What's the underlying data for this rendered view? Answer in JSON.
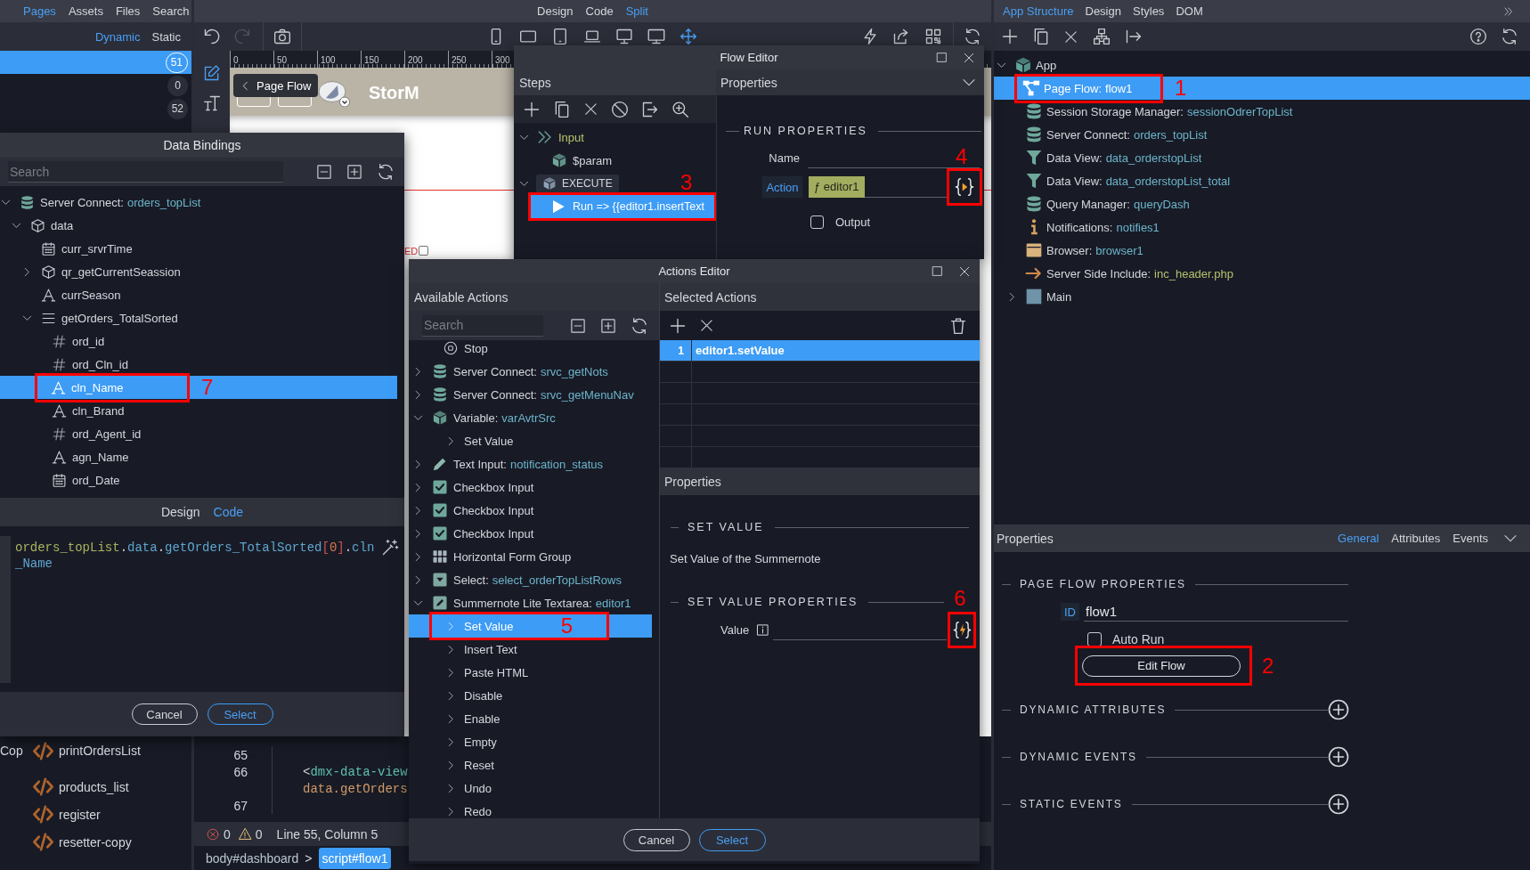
{
  "left_panel": {
    "tabs": [
      {
        "label": "Pages",
        "selected": true
      },
      {
        "label": "Assets",
        "selected": false
      },
      {
        "label": "Files",
        "selected": false
      },
      {
        "label": "Search",
        "selected": false
      }
    ],
    "filter_tabs": [
      {
        "label": "Dynamic",
        "selected": true
      },
      {
        "label": "Static",
        "selected": false
      }
    ],
    "page_rows": [
      {
        "count": "51",
        "selected": true
      },
      {
        "count": "0",
        "selected": false
      },
      {
        "count": "52",
        "selected": false
      }
    ],
    "file_rows": [
      {
        "prefix": "Cop",
        "name": "printOrdersList"
      },
      {
        "name": "products_list"
      },
      {
        "name": "register"
      },
      {
        "name": "resetter-copy"
      }
    ]
  },
  "center": {
    "view_tabs": [
      {
        "label": "Design",
        "selected": false
      },
      {
        "label": "Code",
        "selected": false
      },
      {
        "label": "Split",
        "selected": true
      }
    ],
    "history_buttons": [
      {
        "disabled": false
      },
      {
        "disabled": true
      }
    ],
    "device_buttons": [
      {
        "selected": false
      },
      {
        "selected": false
      },
      {
        "selected": false
      },
      {
        "selected": false
      },
      {
        "selected": false
      },
      {
        "selected": false
      },
      {
        "selected": true
      }
    ],
    "ruler_labels": [
      "0",
      "50",
      "100",
      "150",
      "200",
      "250",
      "300"
    ],
    "canvas": {
      "tooltip": "Page Flow",
      "brand": "StorM",
      "cut_label": "ED",
      "checkbox": {
        "checked": false
      }
    },
    "code_lines": [
      {
        "number": "65"
      },
      {
        "number": "66",
        "kind": "tag",
        "bracket": "<",
        "text": "dmx-data-view"
      },
      {
        "kind": "value",
        "text": "data.getOrders"
      },
      {
        "number": "67"
      }
    ],
    "status_bar": {
      "errors": "0",
      "warnings": "0",
      "position": "Line 55, Column 5"
    },
    "breadcrumb": [
      {
        "label": "body#dashboard",
        "selected": false
      },
      {
        "label": "script#flow1",
        "selected": true
      }
    ],
    "breadcrumb_separator": ">"
  },
  "data_bindings": {
    "title": "Data Bindings",
    "search": {
      "placeholder": "Search"
    },
    "tree": [
      {
        "kind": "server",
        "label": "Server Connect:",
        "value": "orders_topList",
        "expanded": true,
        "selected": false,
        "children": [
          {
            "kind": "object",
            "label": "data",
            "expanded": true,
            "selected": false,
            "children": [
              {
                "kind": "date",
                "label": "curr_srvrTime",
                "selected": false
              },
              {
                "kind": "object",
                "label": "qr_getCurrentSeassion",
                "expanded": false,
                "selected": false
              },
              {
                "kind": "text",
                "label": "currSeason",
                "selected": false
              },
              {
                "kind": "array",
                "label": "getOrders_TotalSorted",
                "expanded": true,
                "selected": false,
                "children": [
                  {
                    "kind": "number",
                    "label": "ord_id",
                    "selected": false
                  },
                  {
                    "kind": "number",
                    "label": "ord_Cln_id",
                    "selected": false
                  },
                  {
                    "kind": "text",
                    "label": "cln_Name",
                    "selected": true,
                    "callout": "7"
                  },
                  {
                    "kind": "text",
                    "label": "cln_Brand",
                    "selected": false
                  },
                  {
                    "kind": "number",
                    "label": "ord_Agent_id",
                    "selected": false
                  },
                  {
                    "kind": "text",
                    "label": "agn_Name",
                    "selected": false
                  },
                  {
                    "kind": "date",
                    "label": "ord_Date",
                    "selected": false
                  }
                ]
              }
            ]
          }
        ]
      }
    ],
    "tabs": [
      {
        "label": "Design",
        "selected": false
      },
      {
        "label": "Code",
        "selected": true
      }
    ],
    "expression": [
      {
        "kind": "root",
        "text": "orders_topList"
      },
      {
        "kind": "punct",
        "text": "."
      },
      {
        "kind": "prop",
        "text": "data"
      },
      {
        "kind": "punct",
        "text": "."
      },
      {
        "kind": "prop",
        "text": "getOrders_TotalSorted"
      },
      {
        "kind": "bracket",
        "text": "["
      },
      {
        "kind": "index",
        "text": "0"
      },
      {
        "kind": "bracket",
        "text": "]"
      },
      {
        "kind": "punct",
        "text": "."
      },
      {
        "kind": "prop",
        "text": "cln_Name"
      }
    ],
    "buttons": [
      {
        "label": "Cancel",
        "kind": "secondary"
      },
      {
        "label": "Select",
        "kind": "primary"
      }
    ]
  },
  "flow_editor": {
    "title": "Flow Editor",
    "steps": {
      "header": "Steps",
      "tree": [
        {
          "kind": "input",
          "label": "Input",
          "expanded": true,
          "selected": false,
          "children": [
            {
              "kind": "param",
              "label": "$param",
              "selected": false
            }
          ]
        },
        {
          "kind": "execute",
          "label": "EXECUTE",
          "expanded": true,
          "selected": false,
          "children": [
            {
              "kind": "run",
              "label": "Run => {{editor1.insertText",
              "selected": true,
              "callout": "3"
            }
          ]
        }
      ]
    },
    "properties": {
      "header": "Properties",
      "section": "RUN PROPERTIES",
      "name_label": "Name",
      "action": {
        "label": "Action",
        "value": "ƒ editor1",
        "callout": "4"
      },
      "output": {
        "label": "Output",
        "checked": false
      }
    }
  },
  "actions_editor": {
    "title": "Actions Editor",
    "available": {
      "header": "Available Actions",
      "search": {
        "placeholder": "Search"
      },
      "items": [
        {
          "kind": "stop",
          "label": "Stop",
          "selected": false
        },
        {
          "kind": "server",
          "label": "Server Connect:",
          "value": "srvc_getNots",
          "expanded": false,
          "selected": false
        },
        {
          "kind": "server",
          "label": "Server Connect:",
          "value": "srvc_getMenuNav",
          "expanded": false,
          "selected": false
        },
        {
          "kind": "variable",
          "label": "Variable:",
          "value": "varAvtrSrc",
          "expanded": true,
          "selected": false,
          "children": [
            {
              "kind": "action",
              "label": "Set Value",
              "expanded": false,
              "selected": false
            }
          ]
        },
        {
          "kind": "text_input",
          "label": "Text Input:",
          "value": "notification_status",
          "expanded": false,
          "selected": false
        },
        {
          "kind": "checkbox",
          "label": "Checkbox Input",
          "expanded": false,
          "selected": false
        },
        {
          "kind": "checkbox",
          "label": "Checkbox Input",
          "expanded": false,
          "selected": false
        },
        {
          "kind": "checkbox",
          "label": "Checkbox Input",
          "expanded": false,
          "selected": false
        },
        {
          "kind": "form_group",
          "label": "Horizontal Form Group",
          "expanded": false,
          "selected": false
        },
        {
          "kind": "select",
          "label": "Select:",
          "value": "select_orderTopListRows",
          "expanded": false,
          "selected": false
        },
        {
          "kind": "summernote",
          "label": "Summernote Lite Textarea:",
          "value": "editor1",
          "expanded": true,
          "selected": false,
          "children": [
            {
              "kind": "action",
              "label": "Set Value",
              "expanded": false,
              "selected": true,
              "callout": "5"
            },
            {
              "kind": "action",
              "label": "Insert Text",
              "expanded": false,
              "selected": false
            },
            {
              "kind": "action",
              "label": "Paste HTML",
              "expanded": false,
              "selected": false
            },
            {
              "kind": "action",
              "label": "Disable",
              "expanded": false,
              "selected": false
            },
            {
              "kind": "action",
              "label": "Enable",
              "expanded": false,
              "selected": false
            },
            {
              "kind": "action",
              "label": "Empty",
              "expanded": false,
              "selected": false
            },
            {
              "kind": "action",
              "label": "Reset",
              "expanded": false,
              "selected": false
            },
            {
              "kind": "action",
              "label": "Undo",
              "expanded": false,
              "selected": false
            },
            {
              "kind": "action",
              "label": "Redo",
              "expanded": false,
              "selected": false
            }
          ]
        }
      ]
    },
    "selected_actions": {
      "header": "Selected Actions",
      "rows": [
        {
          "index": "1",
          "action": "editor1.setValue",
          "selected": true
        }
      ]
    },
    "properties": {
      "header": "Properties",
      "section": "SET VALUE",
      "description": "Set Value of the Summernote",
      "subsection": "SET VALUE PROPERTIES",
      "value_field": {
        "label": "Value",
        "callout": "6"
      }
    },
    "buttons": [
      {
        "label": "Cancel",
        "kind": "secondary"
      },
      {
        "label": "Select",
        "kind": "primary"
      }
    ]
  },
  "app_structure": {
    "tabs": [
      {
        "label": "App Structure",
        "selected": true
      },
      {
        "label": "Design",
        "selected": false
      },
      {
        "label": "Styles",
        "selected": false
      },
      {
        "label": "DOM",
        "selected": false
      }
    ],
    "tree": [
      {
        "kind": "app",
        "label": "App",
        "expanded": true,
        "selected": false,
        "children": [
          {
            "kind": "flow",
            "label": "Page Flow:",
            "value": "flow1",
            "selected": true,
            "callout": "1"
          },
          {
            "kind": "storage",
            "label": "Session Storage Manager:",
            "value": "sessionOdrerTopList",
            "selected": false
          },
          {
            "kind": "server",
            "label": "Server Connect:",
            "value": "orders_topList",
            "selected": false
          },
          {
            "kind": "data_view",
            "label": "Data View:",
            "value": "data_orderstopList",
            "selected": false
          },
          {
            "kind": "data_view",
            "label": "Data View:",
            "value": "data_orderstopList_total",
            "selected": false
          },
          {
            "kind": "query",
            "label": "Query Manager:",
            "value": "queryDash",
            "selected": false
          },
          {
            "kind": "notifications",
            "label": "Notifications:",
            "value": "notifies1",
            "selected": false
          },
          {
            "kind": "browser",
            "label": "Browser:",
            "value": "browser1",
            "selected": false
          },
          {
            "kind": "include",
            "label": "Server Side Include:",
            "value": "inc_header.php",
            "selected": false
          },
          {
            "kind": "main",
            "label": "Main",
            "expanded": false,
            "selected": false
          }
        ]
      }
    ],
    "properties": {
      "header": "Properties",
      "tabs": [
        {
          "label": "General",
          "selected": true
        },
        {
          "label": "Attributes",
          "selected": false
        },
        {
          "label": "Events",
          "selected": false
        }
      ],
      "sections": [
        {
          "kind": "page_flow",
          "title": "PAGE FLOW PROPERTIES",
          "id_label": "ID",
          "id_value": "flow1",
          "auto_run": {
            "label": "Auto Run",
            "checked": false
          },
          "edit_button": {
            "label": "Edit Flow",
            "callout": "2"
          }
        },
        {
          "kind": "addable",
          "title": "DYNAMIC ATTRIBUTES"
        },
        {
          "kind": "addable",
          "title": "DYNAMIC EVENTS"
        },
        {
          "kind": "addable",
          "title": "STATIC EVENTS"
        }
      ]
    }
  }
}
